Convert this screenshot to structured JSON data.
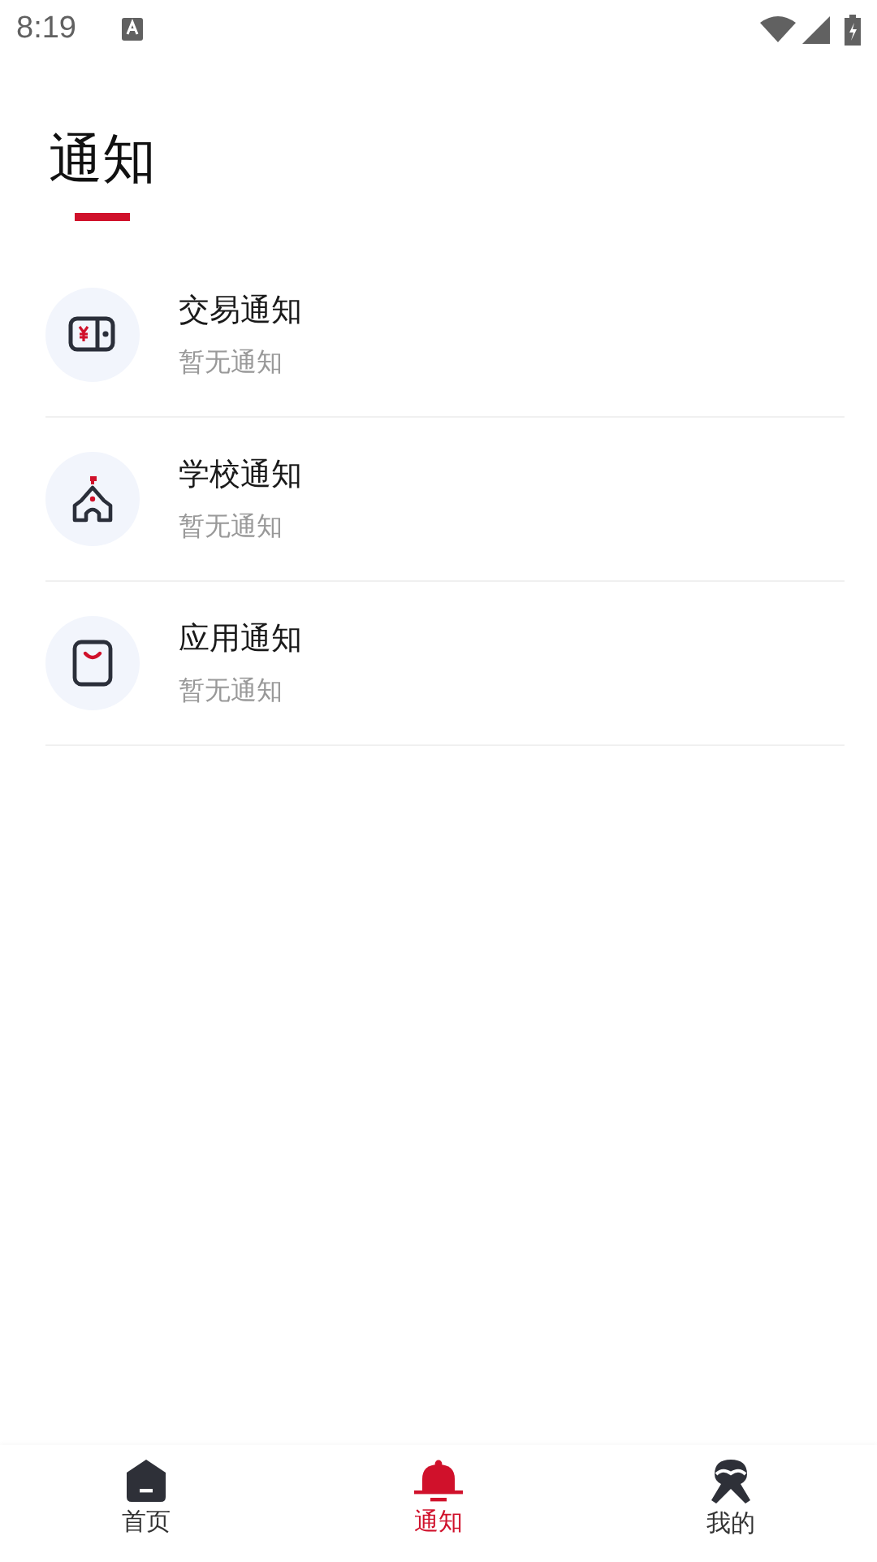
{
  "status_bar": {
    "time": "8:19"
  },
  "title": "通知",
  "notices": [
    {
      "kind": "trade",
      "title": "交易通知",
      "subtitle": "暂无通知"
    },
    {
      "kind": "school",
      "title": "学校通知",
      "subtitle": "暂无通知"
    },
    {
      "kind": "app",
      "title": "应用通知",
      "subtitle": "暂无通知"
    }
  ],
  "tabs": [
    {
      "kind": "home",
      "label": "首页",
      "selected": false
    },
    {
      "kind": "bell",
      "label": "通知",
      "selected": true
    },
    {
      "kind": "user",
      "label": "我的",
      "selected": false
    }
  ]
}
